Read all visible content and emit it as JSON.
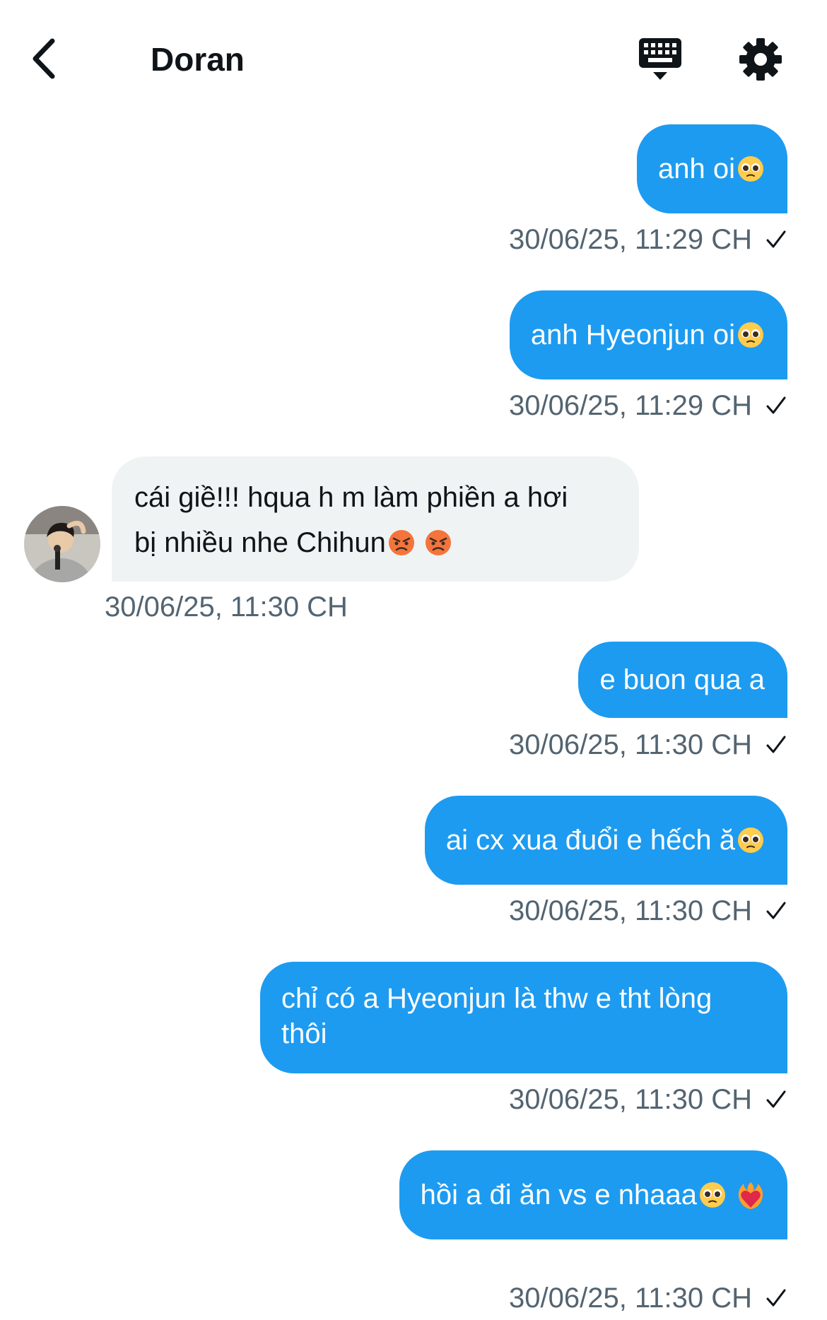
{
  "header": {
    "title": "Doran",
    "back_icon": "chevron-left-icon",
    "keyboard_icon": "keyboard-icon",
    "settings_icon": "gear-icon"
  },
  "colors": {
    "outgoing_bubble": "#1d9bf0",
    "incoming_bubble": "#eff3f4",
    "timestamp": "#536471"
  },
  "messages": [
    {
      "direction": "outgoing",
      "text": "anh oi",
      "emoji": [
        "pleading-face-icon"
      ],
      "timestamp": "30/06/25, 11:29 CH",
      "status": "sent-check-icon"
    },
    {
      "direction": "outgoing",
      "text": "anh Hyeonjun oi",
      "emoji": [
        "pleading-face-icon"
      ],
      "timestamp": "30/06/25, 11:29 CH",
      "status": "sent-check-icon"
    },
    {
      "direction": "incoming",
      "line1": "cái giề!!! hqua h m làm phiền a hơi",
      "line2": "bị nhiều nhe Chihun",
      "emoji": [
        "angry-face-icon",
        "angry-face-icon"
      ],
      "timestamp": "30/06/25, 11:30 CH",
      "avatar_icon": "avatar"
    },
    {
      "direction": "outgoing",
      "text": "e buon qua a",
      "emoji": [],
      "timestamp": "30/06/25, 11:30 CH",
      "status": "sent-check-icon"
    },
    {
      "direction": "outgoing",
      "text": "ai cx xua đuổi e hếch ă",
      "emoji": [
        "pleading-face-icon"
      ],
      "timestamp": "30/06/25, 11:30 CH",
      "status": "sent-check-icon"
    },
    {
      "direction": "outgoing",
      "line1": "chỉ có a Hyeonjun là thw e tht lòng",
      "line2": "thôi",
      "emoji": [],
      "timestamp": "30/06/25, 11:30 CH",
      "status": "sent-check-icon"
    },
    {
      "direction": "outgoing",
      "text": "hồi a đi ăn vs e nhaaa",
      "emoji": [
        "pleading-face-icon",
        "heart-on-fire-icon"
      ],
      "timestamp": "30/06/25, 11:30 CH",
      "status": "sent-check-icon"
    }
  ]
}
